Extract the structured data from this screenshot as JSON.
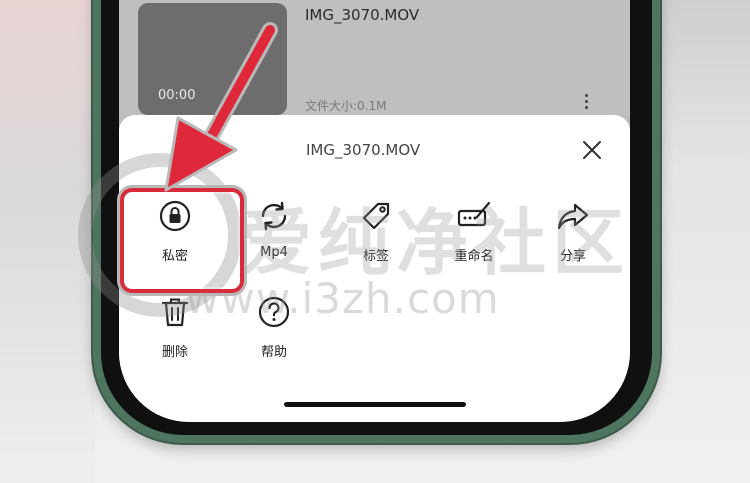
{
  "file": {
    "name": "IMG_3070.MOV",
    "duration": "00:00",
    "size": "文件大小:0.1M"
  },
  "sheet": {
    "title": "IMG_3070.MOV",
    "actions": [
      {
        "label": "私密",
        "icon": "lock-icon"
      },
      {
        "label": "Mp4",
        "icon": "convert-icon"
      },
      {
        "label": "标签",
        "icon": "tag-icon"
      },
      {
        "label": "重命名",
        "icon": "rename-icon"
      },
      {
        "label": "分享",
        "icon": "share-icon"
      },
      {
        "label": "删除",
        "icon": "trash-icon"
      },
      {
        "label": "帮助",
        "icon": "help-icon"
      }
    ]
  },
  "watermark": {
    "chars": "爱纯净社区",
    "url": "www.i3zh.com"
  },
  "colors": {
    "accent": "#d92b3a",
    "phone_frame": "#4e7560",
    "sheet_bg": "#ffffff"
  }
}
